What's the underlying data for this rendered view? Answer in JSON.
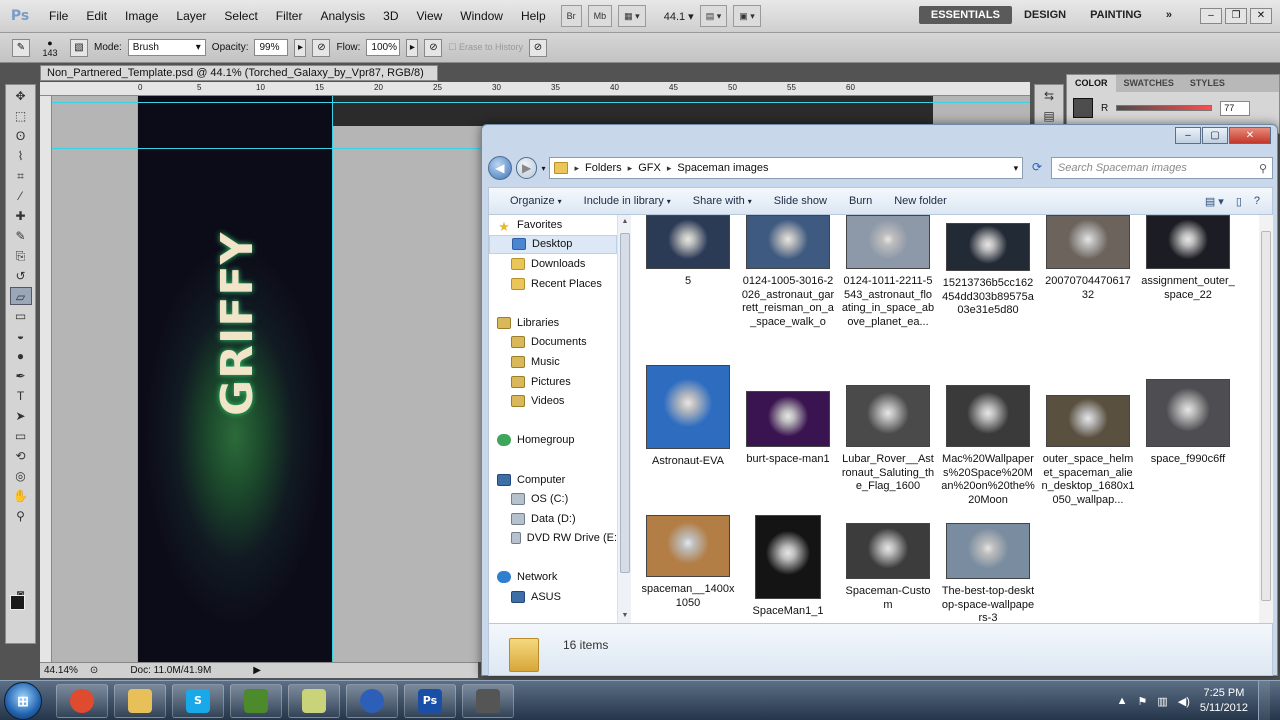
{
  "photoshop": {
    "logo": "Ps",
    "menu": [
      "File",
      "Edit",
      "Image",
      "Layer",
      "Select",
      "Filter",
      "Analysis",
      "3D",
      "View",
      "Window",
      "Help"
    ],
    "mini_buttons": [
      "Br",
      "Mb"
    ],
    "zoom_menu": "44.1",
    "workspaces": [
      "ESSENTIALS",
      "DESIGN",
      "PAINTING",
      "»"
    ],
    "options": {
      "brush_size": "143",
      "mode_label": "Mode:",
      "mode_value": "Brush",
      "opacity_label": "Opacity:",
      "opacity_value": "99%",
      "flow_label": "Flow:",
      "flow_value": "100%",
      "erase_to_history": "Erase to History"
    },
    "document_tab": "Non_Partnered_Template.psd @ 44.1% (Torched_Galaxy_by_Vpr87, RGB/8) *",
    "document_tab_close": "×",
    "ruler_ticks": [
      "0",
      "5",
      "10",
      "15",
      "20",
      "25",
      "30",
      "35",
      "40",
      "45",
      "50",
      "55",
      "60"
    ],
    "canvas_text": "GRIFFY",
    "status": {
      "zoom": "44.14%",
      "doc": "Doc: 11.0M/41.9M"
    },
    "color_panel": {
      "tabs": [
        "COLOR",
        "SWATCHES",
        "STYLES"
      ],
      "channel": "R",
      "value": "77",
      "fg_color": "#4d4d4d"
    }
  },
  "explorer": {
    "breadcrumbs": [
      "Folders",
      "GFX",
      "Spaceman images"
    ],
    "search_placeholder": "Search Spaceman images",
    "toolbar": [
      {
        "label": "Organize",
        "dropdown": "▾"
      },
      {
        "label": "Include in library",
        "dropdown": "▾"
      },
      {
        "label": "Share with",
        "dropdown": "▾"
      },
      {
        "label": "Slide show",
        "dropdown": ""
      },
      {
        "label": "Burn",
        "dropdown": ""
      },
      {
        "label": "New folder",
        "dropdown": ""
      }
    ],
    "nav": [
      {
        "label": "Favorites",
        "icon": "star-icon",
        "sub": false
      },
      {
        "label": "Desktop",
        "icon": "desktop-icon",
        "sub": true,
        "selected": true
      },
      {
        "label": "Downloads",
        "icon": "downloads-icon",
        "sub": true
      },
      {
        "label": "Recent Places",
        "icon": "recent-places-icon",
        "sub": true
      },
      {
        "label": "",
        "gap": true
      },
      {
        "label": "Libraries",
        "icon": "libraries-icon",
        "sub": false
      },
      {
        "label": "Documents",
        "icon": "documents-icon",
        "sub": true
      },
      {
        "label": "Music",
        "icon": "music-icon",
        "sub": true
      },
      {
        "label": "Pictures",
        "icon": "pictures-icon",
        "sub": true
      },
      {
        "label": "Videos",
        "icon": "videos-icon",
        "sub": true
      },
      {
        "label": "",
        "gap": true
      },
      {
        "label": "Homegroup",
        "icon": "homegroup-icon",
        "sub": false
      },
      {
        "label": "",
        "gap": true
      },
      {
        "label": "Computer",
        "icon": "computer-icon",
        "sub": false
      },
      {
        "label": "OS (C:)",
        "icon": "drive-icon",
        "sub": true
      },
      {
        "label": "Data (D:)",
        "icon": "drive-icon",
        "sub": true
      },
      {
        "label": "DVD RW Drive (E:",
        "icon": "dvd-drive-icon",
        "sub": true
      },
      {
        "label": "",
        "gap": true
      },
      {
        "label": "Network",
        "icon": "network-icon",
        "sub": false
      },
      {
        "label": "ASUS",
        "icon": "network-computer-icon",
        "sub": true
      }
    ],
    "files": [
      {
        "name": "5",
        "thumb": "#2b3a55"
      },
      {
        "name": "0124-1005-3016-2026_astronaut_garrett_reisman_on_a_space_walk_o",
        "thumb": "#3f5a80"
      },
      {
        "name": "0124-1011-2211-5543_astronaut_floating_in_space_above_planet_ea...",
        "thumb": "#8d98a8"
      },
      {
        "name": "15213736b5cc162454dd303b89575a03e31e5d80",
        "thumb": "#222a36"
      },
      {
        "name": "20070704470617 32",
        "thumb": "#6c645c"
      },
      {
        "name": "assignment_outer_space_22",
        "thumb": "#1c1c24"
      },
      {
        "name": "Astronaut-EVA",
        "thumb": "#2e6cc0"
      },
      {
        "name": "burt-space-man1",
        "thumb": "#3a1450"
      },
      {
        "name": "Lubar_Rover__Astronaut_Saluting_the_Flag_1600",
        "thumb": "#4a4a4a"
      },
      {
        "name": "Mac%20Wallpapers%20Space%20Man%20on%20the%20Moon",
        "thumb": "#3a3a3a"
      },
      {
        "name": "outer_space_helmet_spaceman_alien_desktop_1680x1050_wallpap...",
        "thumb": "#5a5040"
      },
      {
        "name": "space_f990c6ff",
        "thumb": "#4e4e52"
      },
      {
        "name": "spaceman__1400x1050",
        "thumb": "#b27e46"
      },
      {
        "name": "SpaceMan1_1",
        "thumb": "#141414"
      },
      {
        "name": "Spaceman-Custom",
        "thumb": "#3c3c3c"
      },
      {
        "name": "The-best-top-desktop-space-wallpapers-3",
        "thumb": "#7a8da0"
      }
    ],
    "item_count": "16 items"
  },
  "taskbar": {
    "apps": [
      {
        "name": "chrome",
        "glyph": "",
        "color": "#e04a2e"
      },
      {
        "name": "explorer",
        "glyph": "",
        "color": "#e8c05a"
      },
      {
        "name": "skype",
        "glyph": "S",
        "color": "#19a9e8"
      },
      {
        "name": "minecraft",
        "glyph": "",
        "color": "#4c8a2c"
      },
      {
        "name": "notes",
        "glyph": "",
        "color": "#c9d47a"
      },
      {
        "name": "browser-globe",
        "glyph": "",
        "color": "#2d5fb8"
      },
      {
        "name": "photoshop",
        "glyph": "Ps",
        "color": "#1a4fa8"
      },
      {
        "name": "tool",
        "glyph": "",
        "color": "#555555"
      }
    ],
    "time": "7:25 PM",
    "date": "5/11/2012"
  }
}
